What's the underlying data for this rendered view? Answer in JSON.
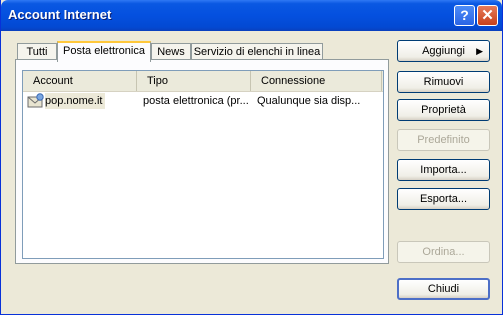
{
  "window": {
    "title": "Account Internet"
  },
  "titlebar_buttons": {
    "help": "?",
    "close": "✕"
  },
  "tabs": [
    "Tutti",
    "Posta elettronica",
    "News",
    "Servizio di elenchi in linea"
  ],
  "active_tab": "Posta elettronica",
  "list": {
    "columns": [
      "Account",
      "Tipo",
      "Connessione"
    ],
    "rows": [
      {
        "account": "pop.nome.it",
        "type": "posta elettronica (pr...",
        "connection": "Qualunque sia disp...",
        "icon": "mail-account-icon"
      }
    ]
  },
  "buttons": {
    "add": "Aggiungi",
    "remove": "Rimuovi",
    "properties": "Proprietà",
    "default": "Predefinito",
    "import": "Importa...",
    "export": "Esporta...",
    "order": "Ordina...",
    "close": "Chiudi"
  },
  "colors": {
    "titlebar": "#0450df",
    "face": "#ece9d8",
    "tab_highlight": "#ffc83c"
  }
}
